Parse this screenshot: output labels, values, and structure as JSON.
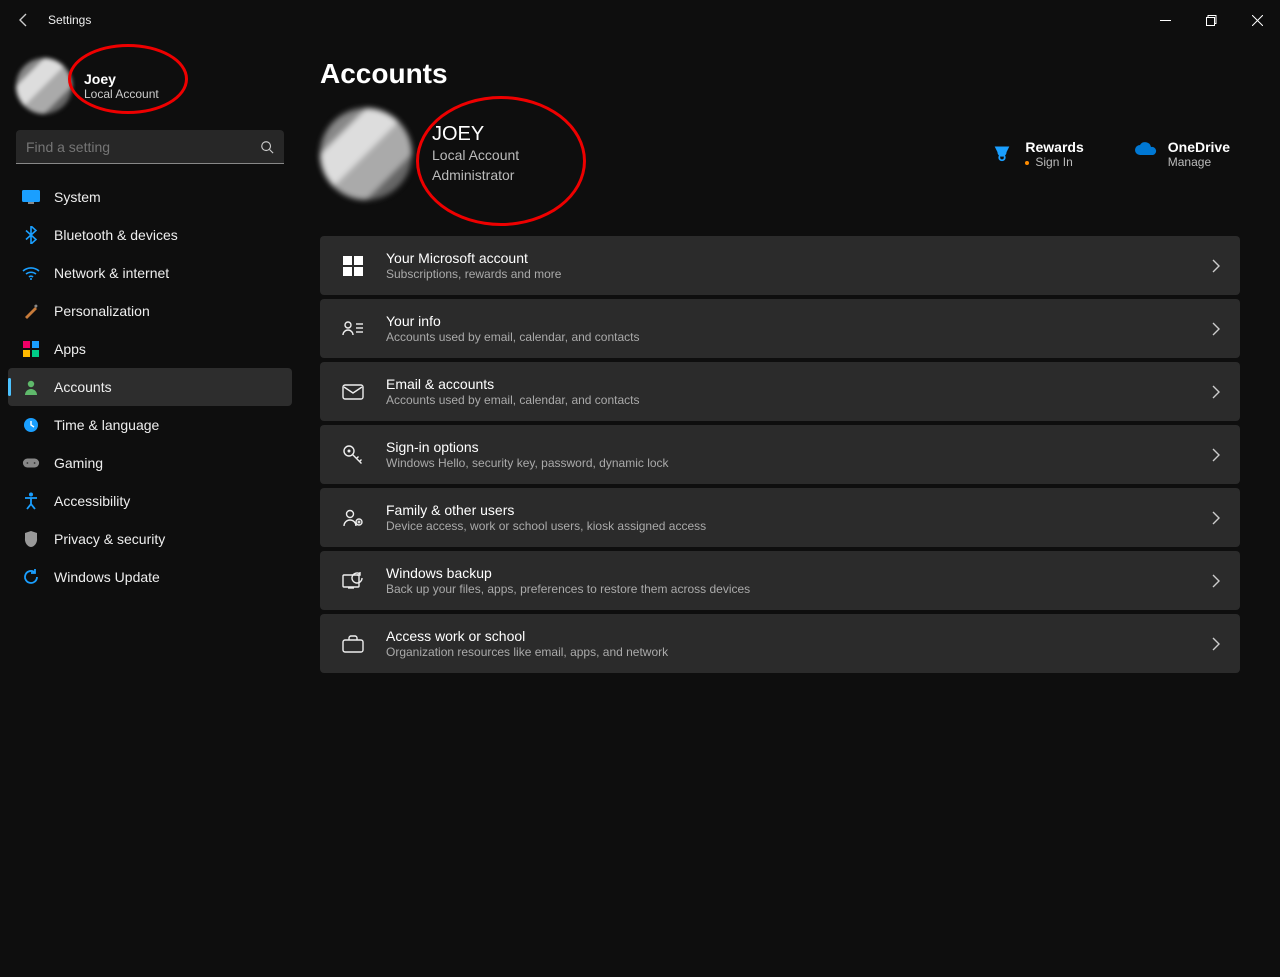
{
  "app": {
    "title": "Settings"
  },
  "sidebar_user": {
    "name": "Joey",
    "subtitle": "Local Account"
  },
  "search": {
    "placeholder": "Find a setting"
  },
  "nav": {
    "items": [
      {
        "label": "System",
        "icon": "system"
      },
      {
        "label": "Bluetooth & devices",
        "icon": "bluetooth"
      },
      {
        "label": "Network & internet",
        "icon": "wifi"
      },
      {
        "label": "Personalization",
        "icon": "personalization"
      },
      {
        "label": "Apps",
        "icon": "apps"
      },
      {
        "label": "Accounts",
        "icon": "accounts",
        "active": true
      },
      {
        "label": "Time & language",
        "icon": "time"
      },
      {
        "label": "Gaming",
        "icon": "gaming"
      },
      {
        "label": "Accessibility",
        "icon": "accessibility"
      },
      {
        "label": "Privacy & security",
        "icon": "privacy"
      },
      {
        "label": "Windows Update",
        "icon": "update"
      }
    ]
  },
  "page": {
    "title": "Accounts"
  },
  "hero": {
    "name": "JOEY",
    "line1": "Local Account",
    "line2": "Administrator",
    "rewards": {
      "title": "Rewards",
      "sub": "Sign In"
    },
    "onedrive": {
      "title": "OneDrive",
      "sub": "Manage"
    }
  },
  "cards": [
    {
      "title": "Your Microsoft account",
      "sub": "Subscriptions, rewards and more",
      "icon": "microsoft"
    },
    {
      "title": "Your info",
      "sub": "Accounts used by email, calendar, and contacts",
      "icon": "info"
    },
    {
      "title": "Email & accounts",
      "sub": "Accounts used by email, calendar, and contacts",
      "icon": "email"
    },
    {
      "title": "Sign-in options",
      "sub": "Windows Hello, security key, password, dynamic lock",
      "icon": "key"
    },
    {
      "title": "Family & other users",
      "sub": "Device access, work or school users, kiosk assigned access",
      "icon": "family"
    },
    {
      "title": "Windows backup",
      "sub": "Back up your files, apps, preferences to restore them across devices",
      "icon": "backup"
    },
    {
      "title": "Access work or school",
      "sub": "Organization resources like email, apps, and network",
      "icon": "briefcase"
    }
  ]
}
